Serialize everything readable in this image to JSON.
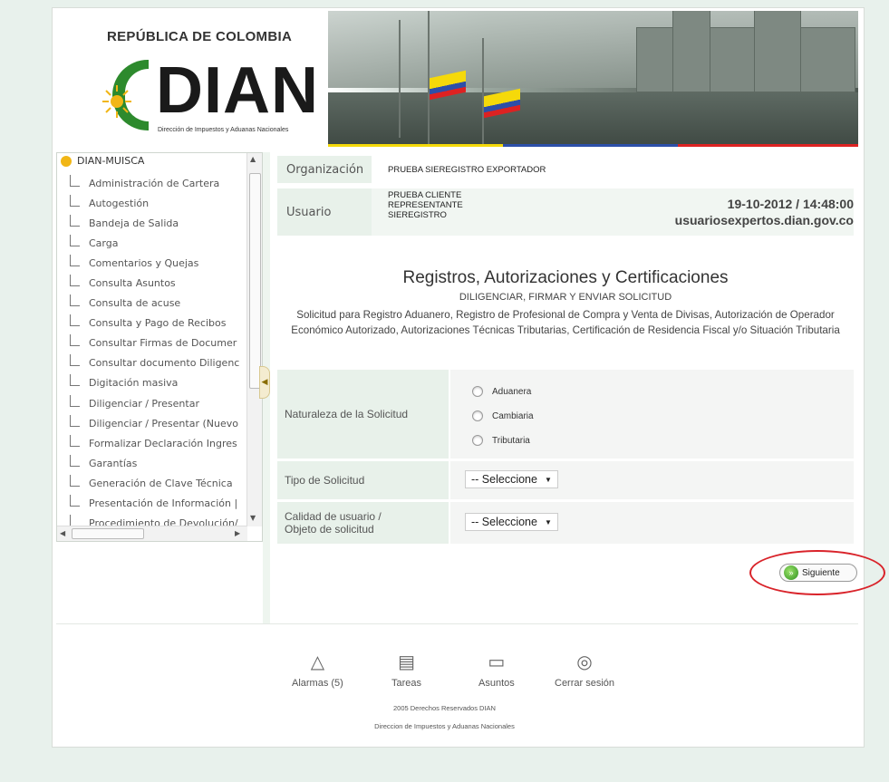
{
  "header": {
    "republica": "REPÚBLICA DE COLOMBIA",
    "logo_text": "DIAN",
    "logo_subtitle": "Dirección de Impuestos y Aduanas Nacionales"
  },
  "sidebar": {
    "root": "DIAN-MUISCA",
    "items": [
      "Administración de Cartera",
      "Autogestión",
      "Bandeja de Salida",
      "Carga",
      "Comentarios y Quejas",
      "Consulta Asuntos",
      "Consulta de acuse",
      "Consulta y Pago de Recibos",
      "Consultar Firmas de Documer",
      "Consultar documento Diligenc",
      "Digitación masiva",
      "Diligenciar / Presentar",
      "Diligenciar / Presentar (Nuevo",
      "Formalizar Declaración Ingres",
      "Garantías",
      "Generación de Clave Técnica",
      "Presentación de Información |",
      "Procedimiento de Devolución/"
    ]
  },
  "info": {
    "organizacion_label": "Organización",
    "organizacion_value": "PRUEBA SIEREGISTRO EXPORTADOR",
    "usuario_label": "Usuario",
    "usuario_line1": "PRUEBA CLIENTE",
    "usuario_line2": "REPRESENTANTE",
    "usuario_line3": "SIEREGISTRO",
    "datetime": "19-10-2012 / 14:48:00",
    "domain": "usuariosexpertos.dian.gov.co"
  },
  "page": {
    "title": "Registros, Autorizaciones y Certificaciones",
    "subtitle": "DILIGENCIAR, FIRMAR Y ENVIAR SOLICITUD",
    "description": "Solicitud para Registro Aduanero, Registro de Profesional de Compra y Venta de Divisas, Autorización de Operador Económico Autorizado, Autorizaciones Técnicas Tributarias, Certificación de Residencia Fiscal y/o Situación Tributaria"
  },
  "form": {
    "naturaleza_label": "Naturaleza de la Solicitud",
    "naturaleza_options": [
      "Aduanera",
      "Cambiaria",
      "Tributaria"
    ],
    "tipo_label": "Tipo de Solicitud",
    "tipo_value": "-- Seleccione",
    "calidad_label_line1": "Calidad de usuario /",
    "calidad_label_line2": "Objeto de solicitud",
    "calidad_value": "-- Seleccione"
  },
  "actions": {
    "next_label": "Siguiente"
  },
  "footer": {
    "alarmas": "Alarmas (5)",
    "tareas": "Tareas",
    "asuntos": "Asuntos",
    "cerrar": "Cerrar sesión",
    "copyright": "2005 Derechos Reservados DIAN",
    "entity": "Direccion de Impuestos y Aduanas Nacionales"
  }
}
